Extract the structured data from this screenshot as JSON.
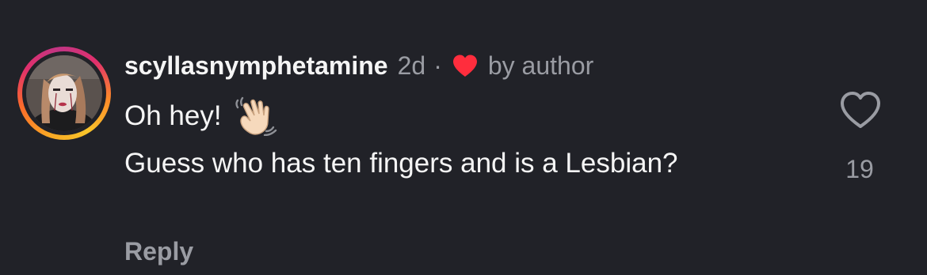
{
  "comment": {
    "username": "scyllasnymphetamine",
    "time": "2d",
    "separator": "·",
    "author_badge": "by author",
    "text_line1": "Oh hey!",
    "emoji": "waving-hand",
    "text_line2": "Guess who has ten fingers and is a Lesbian?",
    "reply_label": "Reply",
    "like_count": "19"
  },
  "colors": {
    "background": "#212228",
    "primary_text": "#f5f5f5",
    "secondary_text": "#9a9ca3",
    "heart_red": "#ff2d3d",
    "story_ring": "#e1306c"
  }
}
